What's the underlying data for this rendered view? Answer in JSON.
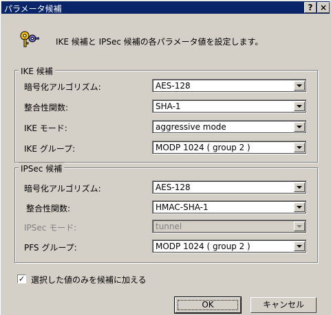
{
  "window": {
    "title": "パラメータ候補",
    "help_label": "?",
    "close_label": "×"
  },
  "description": "IKE 候補と IPSec 候補の各パラメータ値を設定します。",
  "ike": {
    "legend": "IKE 候補",
    "rows": [
      {
        "label": "暗号化アルゴリズム:",
        "value": "AES-128"
      },
      {
        "label": "整合性関数:",
        "value": "SHA-1"
      },
      {
        "label": "IKE モード:",
        "value": "aggressive mode"
      },
      {
        "label": "IKE グループ:",
        "value": "MODP 1024 ( group 2 )"
      }
    ]
  },
  "ipsec": {
    "legend": "IPSec 候補",
    "rows": [
      {
        "label": "暗号化アルゴリズム:",
        "value": "AES-128"
      },
      {
        "label": "整合性関数:",
        "value": "HMAC-SHA-1"
      },
      {
        "label": "IPSec モード:",
        "value": "tunnel",
        "disabled": true
      },
      {
        "label": "PFS グループ:",
        "value": "MODP 1024 ( group 2 )"
      }
    ]
  },
  "checkbox": {
    "label": "選択した値のみを候補に加える",
    "checked": true,
    "mark": "✓"
  },
  "buttons": {
    "ok": "OK",
    "cancel": "キャンセル"
  }
}
